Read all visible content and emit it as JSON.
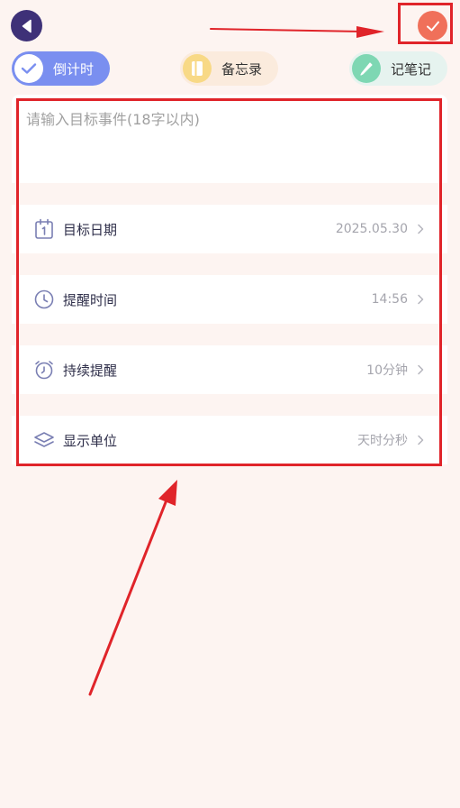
{
  "header": {
    "back_icon": "back-triangle-icon",
    "confirm_icon": "checkmark-icon"
  },
  "tabs": [
    {
      "label": "倒计时",
      "icon": "check-circle-icon",
      "active": true,
      "color": "#7a8ff0"
    },
    {
      "label": "备忘录",
      "icon": "notebook-icon",
      "active": false,
      "color": "#f8d986"
    },
    {
      "label": "记笔记",
      "icon": "pencil-icon",
      "active": false,
      "color": "#7ed7b3"
    }
  ],
  "form": {
    "title_placeholder": "请输入目标事件(18字以内)",
    "rows": [
      {
        "label": "目标日期",
        "value": "2025.05.30",
        "icon": "calendar-icon"
      },
      {
        "label": "提醒时间",
        "value": "14:56",
        "icon": "clock-icon"
      },
      {
        "label": "持续提醒",
        "value": "10分钟",
        "icon": "alarm-clock-icon"
      },
      {
        "label": "显示单位",
        "value": "天时分秒",
        "icon": "layers-icon"
      }
    ]
  },
  "colors": {
    "background": "#fdf4f1",
    "primary_dark": "#3e3178",
    "confirm": "#f0705a",
    "annotation_red": "#e0242a",
    "icon_stroke": "#7a7fb3"
  }
}
